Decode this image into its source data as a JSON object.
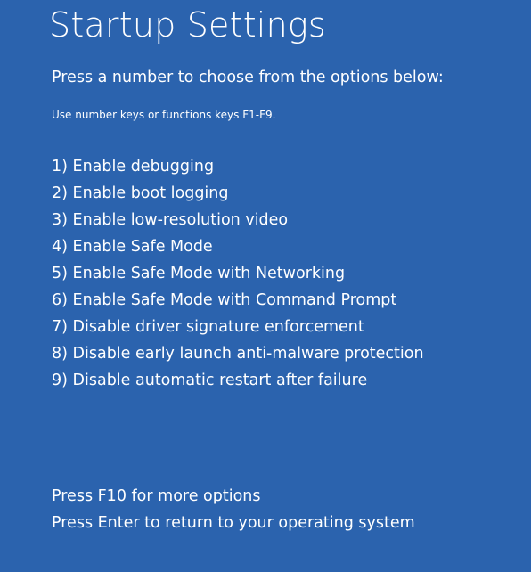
{
  "screen": {
    "title": "Startup Settings",
    "subtitle": "Press a number to choose from the options below:",
    "hint": "Use number keys or functions keys F1-F9.",
    "background_color": "#2b63ae",
    "text_color": "#ffffff"
  },
  "options": [
    "1) Enable debugging",
    "2) Enable boot logging",
    "3) Enable low-resolution video",
    "4) Enable Safe Mode",
    "5) Enable Safe Mode with Networking",
    "6) Enable Safe Mode with Command Prompt",
    "7) Disable driver signature enforcement",
    "8) Disable early launch anti-malware protection",
    "9) Disable automatic restart after failure"
  ],
  "footer": {
    "more_options": "Press F10 for more options",
    "return": "Press Enter to return to your operating system"
  }
}
